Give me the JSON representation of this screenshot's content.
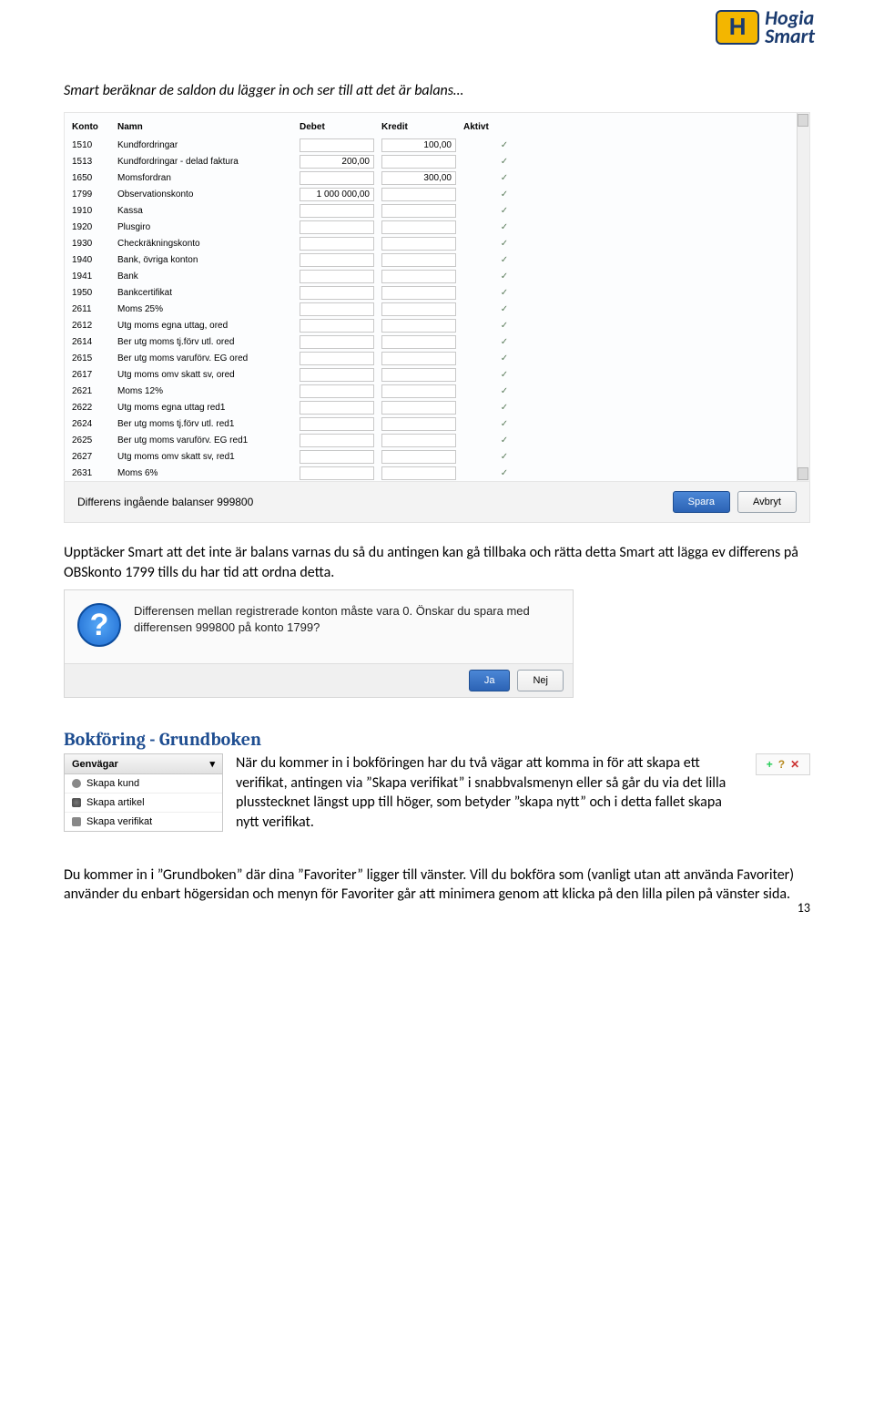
{
  "logo": {
    "mark": "H",
    "line1": "Hogia",
    "line2": "Smart"
  },
  "intro": "Smart beräknar de saldon du lägger in och ser till att det är balans…",
  "table": {
    "headers": {
      "konto": "Konto",
      "namn": "Namn",
      "debet": "Debet",
      "kredit": "Kredit",
      "aktivt": "Aktivt"
    },
    "rows": [
      {
        "konto": "1510",
        "namn": "Kundfordringar",
        "debet": "",
        "kredit": "100,00",
        "aktivt": true
      },
      {
        "konto": "1513",
        "namn": "Kundfordringar - delad faktura",
        "debet": "200,00",
        "kredit": "",
        "aktivt": true
      },
      {
        "konto": "1650",
        "namn": "Momsfordran",
        "debet": "",
        "kredit": "300,00",
        "aktivt": true
      },
      {
        "konto": "1799",
        "namn": "Observationskonto",
        "debet": "1 000 000,00",
        "kredit": "",
        "aktivt": true
      },
      {
        "konto": "1910",
        "namn": "Kassa",
        "debet": "",
        "kredit": "",
        "aktivt": true
      },
      {
        "konto": "1920",
        "namn": "Plusgiro",
        "debet": "",
        "kredit": "",
        "aktivt": true
      },
      {
        "konto": "1930",
        "namn": "Checkräkningskonto",
        "debet": "",
        "kredit": "",
        "aktivt": true
      },
      {
        "konto": "1940",
        "namn": "Bank, övriga konton",
        "debet": "",
        "kredit": "",
        "aktivt": true
      },
      {
        "konto": "1941",
        "namn": "Bank",
        "debet": "",
        "kredit": "",
        "aktivt": true
      },
      {
        "konto": "1950",
        "namn": "Bankcertifikat",
        "debet": "",
        "kredit": "",
        "aktivt": true
      },
      {
        "konto": "2611",
        "namn": "Moms 25%",
        "debet": "",
        "kredit": "",
        "aktivt": true
      },
      {
        "konto": "2612",
        "namn": "Utg moms egna uttag, ored",
        "debet": "",
        "kredit": "",
        "aktivt": true
      },
      {
        "konto": "2614",
        "namn": "Ber utg moms tj.förv utl. ored",
        "debet": "",
        "kredit": "",
        "aktivt": true
      },
      {
        "konto": "2615",
        "namn": "Ber utg moms varuförv. EG ored",
        "debet": "",
        "kredit": "",
        "aktivt": true
      },
      {
        "konto": "2617",
        "namn": "Utg moms omv skatt sv, ored",
        "debet": "",
        "kredit": "",
        "aktivt": true
      },
      {
        "konto": "2621",
        "namn": "Moms 12%",
        "debet": "",
        "kredit": "",
        "aktivt": true
      },
      {
        "konto": "2622",
        "namn": "Utg moms egna uttag red1",
        "debet": "",
        "kredit": "",
        "aktivt": true
      },
      {
        "konto": "2624",
        "namn": "Ber utg moms tj.förv utl. red1",
        "debet": "",
        "kredit": "",
        "aktivt": true
      },
      {
        "konto": "2625",
        "namn": "Ber utg moms varuförv. EG red1",
        "debet": "",
        "kredit": "",
        "aktivt": true
      },
      {
        "konto": "2627",
        "namn": "Utg moms omv skatt sv, red1",
        "debet": "",
        "kredit": "",
        "aktivt": true
      },
      {
        "konto": "2631",
        "namn": "Moms 6%",
        "debet": "",
        "kredit": "",
        "aktivt": true
      }
    ]
  },
  "footer": {
    "diff_label": "Differens ingående balanser  999800",
    "save": "Spara",
    "cancel": "Avbryt"
  },
  "para1": "Upptäcker Smart att det inte är balans varnas du så du antingen kan gå tillbaka och rätta detta Smart att lägga ev differens på OBSkonto 1799 tills du har tid att ordna detta.",
  "dialog": {
    "text": "Differensen mellan registrerade konton måste vara 0. Önskar du spara med differensen 999800 på konto 1799?",
    "yes": "Ja",
    "no": "Nej"
  },
  "section_heading": "Bokföring - Grundboken",
  "sidemenu": {
    "header": "Genvägar",
    "caret": "▾",
    "items": [
      "Skapa kund",
      "Skapa artikel",
      "Skapa verifikat"
    ]
  },
  "grund_text": "När du kommer in i bokföringen har du två vägar att komma in för att skapa ett verifikat, antingen via ”Skapa verifikat” i snabbvalsmenyn eller så går du via det lilla plusstecknet längst upp till höger, som betyder ”skapa nytt” och i detta fallet skapa nytt verifikat.",
  "toolbar": {
    "plus": "+",
    "help": "?",
    "close": "✕"
  },
  "para2": "Du kommer in i ”Grundboken” där dina ”Favoriter” ligger till vänster. Vill du bokföra som (vanligt utan att använda Favoriter) använder du enbart högersidan och menyn för Favoriter går att minimera genom att klicka på den lilla pilen på vänster sida.",
  "page_number": "13"
}
